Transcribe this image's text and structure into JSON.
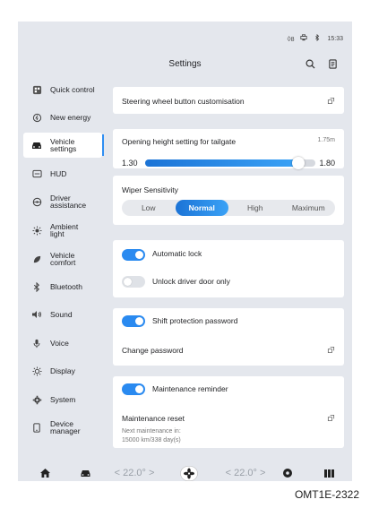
{
  "status": {
    "icon1": "◊",
    "icon1_value": "8",
    "time": "15:33"
  },
  "header": {
    "title": "Settings"
  },
  "sidebar": {
    "items": [
      {
        "label": "Quick control"
      },
      {
        "label": "New energy"
      },
      {
        "label": "Vehicle\nsettings"
      },
      {
        "label": "HUD"
      },
      {
        "label": "Driver\nassistance"
      },
      {
        "label": "Ambient\nlight"
      },
      {
        "label": "Vehicle\ncomfort"
      },
      {
        "label": "Bluetooth"
      },
      {
        "label": "Sound"
      },
      {
        "label": "Voice"
      },
      {
        "label": "Display"
      },
      {
        "label": "System"
      },
      {
        "label": "Device\nmanager"
      }
    ]
  },
  "cards": {
    "steering": {
      "label": "Steering wheel button customisation"
    },
    "tailgate": {
      "label": "Opening height setting for tailgate",
      "max_label": "1.75m",
      "min_value": "1.30",
      "max_value": "1.80",
      "level": 0.9
    },
    "wiper": {
      "label": "Wiper Sensitivity",
      "options": [
        "Low",
        "Normal",
        "High",
        "Maximum"
      ],
      "selected": "Normal"
    },
    "lock": {
      "auto_label": "Automatic lock",
      "unlock_label": "Unlock driver door only"
    },
    "shift": {
      "label": "Shift protection password",
      "change_label": "Change password"
    },
    "maintenance": {
      "label": "Maintenance reminder",
      "reset_label": "Maintenance reset",
      "next_label": "Next maintenance in:",
      "next_value": "15000 km/338 day(s)"
    }
  },
  "bottom": {
    "temp_left": "< 22.0° >",
    "temp_right": "< 22.0° >"
  },
  "caption": "OMT1E-2322"
}
